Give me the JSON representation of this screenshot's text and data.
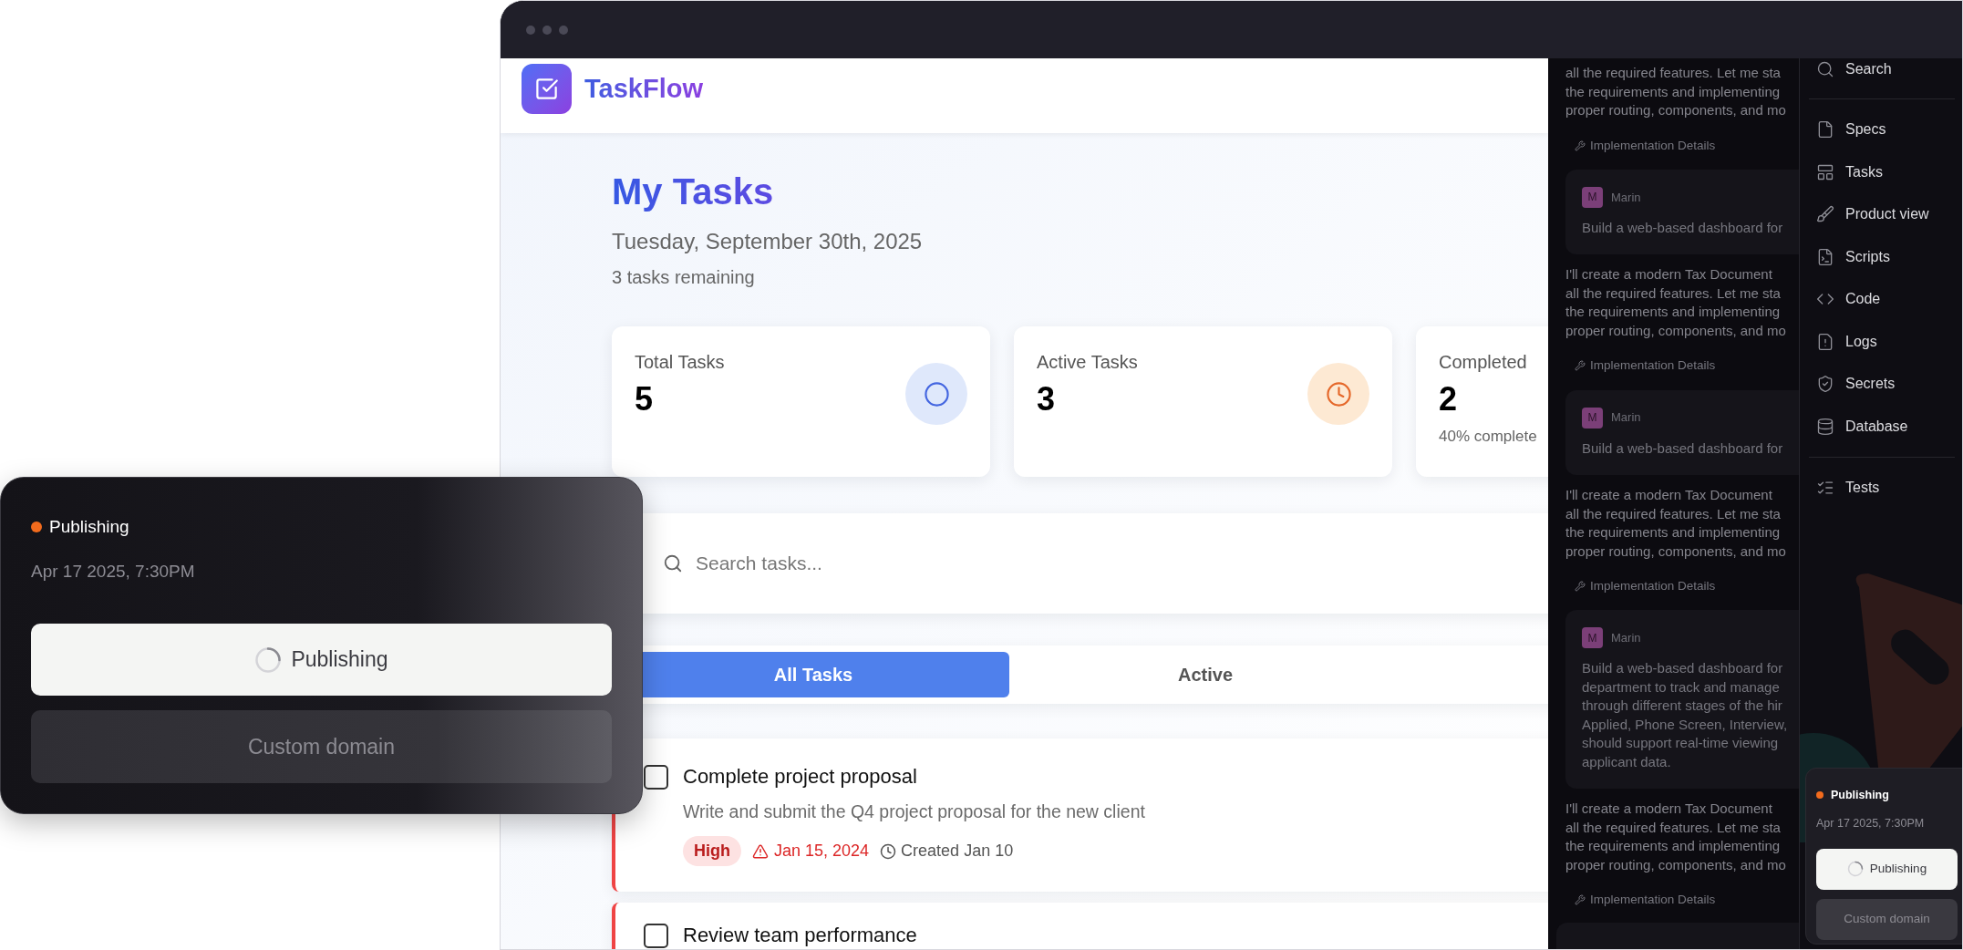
{
  "app": {
    "name": "TaskFlow",
    "title": "My Tasks",
    "date": "Tuesday, September 30th, 2025",
    "remaining": "3 tasks remaining",
    "stats": [
      {
        "label": "Total Tasks",
        "value": "5",
        "kind": "circle"
      },
      {
        "label": "Active Tasks",
        "value": "3",
        "kind": "clock"
      },
      {
        "label": "Completed",
        "value": "2",
        "note": "40% complete",
        "kind": "none"
      }
    ],
    "search": {
      "placeholder": "Search tasks..."
    },
    "tabs": [
      {
        "label": "All Tasks",
        "selected": true
      },
      {
        "label": "Active",
        "selected": false
      }
    ],
    "tasks": [
      {
        "title": "Complete project proposal",
        "description": "Write and submit the Q4 project proposal for the new client",
        "checked": false,
        "kind": "high",
        "priority": "High",
        "due": "Jan 15, 2024",
        "overdue": true,
        "created": "Created Jan 10"
      },
      {
        "title": "Review team performance",
        "checked": false,
        "kind": "high"
      }
    ]
  },
  "chat": [
    {
      "kind": "text",
      "lines": [
        "all the required features. Let me sta",
        "the requirements and implementing",
        "proper routing, components, and mo"
      ]
    },
    {
      "kind": "details",
      "label": "Implementation Details"
    },
    {
      "kind": "message",
      "avatar": "M",
      "author": "Marin",
      "lines": [
        "Build a web-based dashboard for"
      ]
    },
    {
      "kind": "text",
      "lines": [
        "I'll create a modern Tax Document",
        "all the required features. Let me sta",
        "the requirements and implementing",
        "proper routing, components, and mo"
      ]
    },
    {
      "kind": "details",
      "label": "Implementation Details"
    },
    {
      "kind": "message",
      "avatar": "M",
      "author": "Marin",
      "lines": [
        "Build a web-based dashboard for"
      ]
    },
    {
      "kind": "text",
      "lines": [
        "I'll create a modern Tax Document",
        "all the required features. Let me sta",
        "the requirements and implementing",
        "proper routing, components, and mo"
      ]
    },
    {
      "kind": "details",
      "label": "Implementation Details"
    },
    {
      "kind": "message",
      "avatar": "M",
      "author": "Marin",
      "lines": [
        "Build a web-based dashboard for",
        "department to track and manage",
        "through different stages of the hir",
        "Applied, Phone Screen, Interview,",
        "should support real-time viewing",
        "applicant data."
      ]
    },
    {
      "kind": "text",
      "lines": [
        "I'll create a modern Tax Document",
        "all the required features. Let me sta",
        "the requirements and implementing",
        "proper routing, components, and mo"
      ]
    },
    {
      "kind": "details",
      "label": "Implementation Details"
    },
    {
      "kind": "message_stub"
    }
  ],
  "sidebar": {
    "items": [
      {
        "kind": "item",
        "label": "Search"
      },
      {
        "kind": "divider"
      },
      {
        "kind": "item",
        "label": "Specs"
      },
      {
        "kind": "item",
        "label": "Tasks"
      },
      {
        "kind": "item",
        "label": "Product view"
      },
      {
        "kind": "item",
        "label": "Scripts"
      },
      {
        "kind": "item",
        "label": "Code"
      },
      {
        "kind": "item",
        "label": "Logs"
      },
      {
        "kind": "item",
        "label": "Secrets"
      },
      {
        "kind": "item",
        "label": "Database"
      },
      {
        "kind": "divider"
      },
      {
        "kind": "item",
        "label": "Tests"
      }
    ],
    "publish_card": {
      "status": "Publishing",
      "time": "Apr 17 2025, 7:30PM",
      "primary": "Publishing",
      "secondary": "Custom domain"
    }
  },
  "publish_popover": {
    "status": "Publishing",
    "time": "Apr 17 2025, 7:30PM",
    "primary": "Publishing",
    "secondary": "Custom domain"
  }
}
